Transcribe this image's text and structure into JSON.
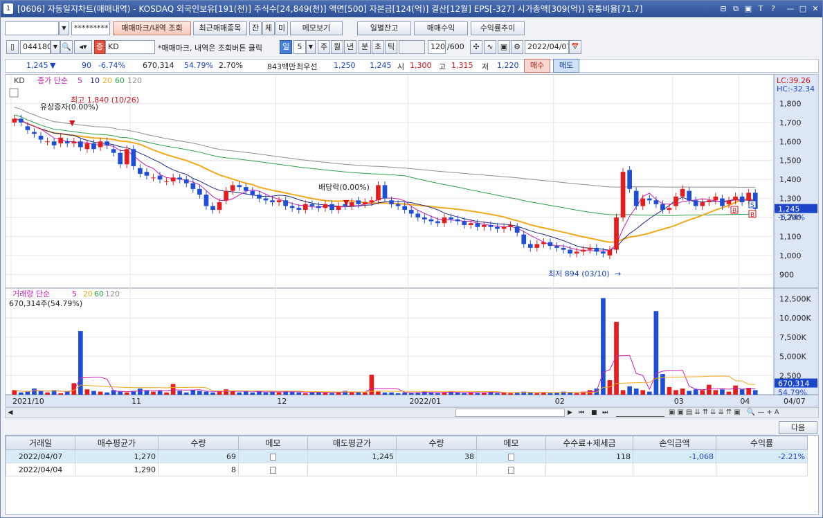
{
  "window": {
    "number": "1",
    "title": "[0606] 자동일지차트(매매내역) - KOSDAQ 외국인보유[191(천)] 주식수[24,849(천)] 액면[500] 자본금[124(억)] 결산[12월] EPS[-327] 시가총액[309(억)] 유통비율[71.7]",
    "controls": [
      "⊟",
      "⧉",
      "▣",
      "T",
      "?",
      "—",
      "□",
      "✕"
    ]
  },
  "toolbar1": {
    "account_value": "",
    "password_value": "*********",
    "btn_trade_mark": "매매마크/내역 조회",
    "btn_recent": "최근매매종목",
    "btn_jan": "잔",
    "btn_che": "체",
    "btn_mi": "미",
    "btn_memo": "메모보기",
    "btn_daily": "일별잔고",
    "btn_profit": "매매수익",
    "btn_yield": "수익률추이"
  },
  "toolbar2": {
    "code": "044180",
    "market": "증",
    "name": "KD",
    "hint": "*매매마크, 내역은 조회버튼 클릭",
    "period_il": "일",
    "period_n": "5",
    "period_ju": "주",
    "period_wol": "월",
    "period_nyeon": "년",
    "period_bun": "분",
    "period_cho": "초",
    "period_tick": "틱",
    "count": "120",
    "count_max": "/600",
    "date": "2022/04/07",
    "search_icon": "🔍",
    "config_icon": "⚙",
    "calendar_icon": "📅"
  },
  "quote": {
    "price": "1,245",
    "arrow": "▼",
    "change": "90",
    "rate": "-6.74%",
    "volume": "670,314",
    "vol_rate": "54.79%",
    "turnover": "2.70%",
    "amount": "843백만",
    "best_label": "최우선",
    "ask": "1,250",
    "bid": "1,245",
    "open_label": "시",
    "open": "1,300",
    "high_label": "고",
    "high": "1,315",
    "low_label": "저",
    "low": "1,220",
    "buy": "매수",
    "sell": "매도"
  },
  "chart_data": [
    {
      "type": "candlestick",
      "title": "KD",
      "legend": [
        "종가 단순",
        "5",
        "10",
        "20",
        "60",
        "120"
      ],
      "colors": {
        "up": "#e41e1e",
        "down": "#1e4ed8",
        "ma5": "#c81fb4",
        "ma10": "#1b2a80",
        "ma20": "#f2a81b",
        "ma60": "#2ea04a",
        "ma120": "#8e8e8e"
      },
      "ylim": [
        850,
        1900
      ],
      "yticks": [
        900,
        1000,
        1100,
        1200,
        1300,
        1400,
        1500,
        1600,
        1700,
        1800
      ],
      "ytick_labels": [
        "900",
        "1,000",
        "1,100",
        "1,200",
        "1,300",
        "1,400",
        "1,500",
        "1,600",
        "1,700",
        "1,800"
      ],
      "x_labels": [
        "2021/10",
        "11",
        "12",
        "2022/01",
        "02",
        "03",
        "04",
        "04/07"
      ],
      "last_price": "1,245",
      "last_rate": "-6.74%",
      "lc": "LC:39.26",
      "hc": "HC:-32.34",
      "annotations": {
        "high": "최고 1,840 (10/26)",
        "low": "최저 894 (03/10)",
        "rights": "유상증자(0.00%)",
        "dividend": "배당락(0.00%)"
      },
      "marks": [
        "S",
        "B",
        "B"
      ],
      "close": [
        1720,
        1700,
        1660,
        1640,
        1610,
        1600,
        1580,
        1620,
        1590,
        1600,
        1570,
        1590,
        1560,
        1600,
        1580,
        1540,
        1480,
        1560,
        1470,
        1430,
        1420,
        1410,
        1400,
        1390,
        1410,
        1400,
        1380,
        1350,
        1320,
        1260,
        1240,
        1280,
        1340,
        1370,
        1360,
        1340,
        1320,
        1300,
        1290,
        1280,
        1290,
        1260,
        1250,
        1240,
        1270,
        1260,
        1250,
        1270,
        1240,
        1260,
        1260,
        1280,
        1270,
        1280,
        1290,
        1370,
        1300,
        1270,
        1260,
        1240,
        1220,
        1200,
        1190,
        1180,
        1170,
        1200,
        1190,
        1180,
        1160,
        1170,
        1150,
        1160,
        1150,
        1140,
        1150,
        1160,
        1120,
        1060,
        1040,
        1060,
        1070,
        1050,
        1040,
        1030,
        1010,
        1020,
        1030,
        1040,
        1020,
        1010,
        1030,
        1200,
        1440,
        1350,
        1260,
        1300,
        1290,
        1270,
        1240,
        1250,
        1310,
        1350,
        1290,
        1260,
        1280,
        1290,
        1310,
        1260,
        1290,
        1310,
        1280,
        1330,
        1245
      ],
      "open": [
        1700,
        1720,
        1680,
        1650,
        1630,
        1600,
        1600,
        1590,
        1600,
        1590,
        1600,
        1560,
        1590,
        1570,
        1600,
        1560,
        1540,
        1480,
        1560,
        1460,
        1440,
        1410,
        1420,
        1390,
        1390,
        1410,
        1400,
        1380,
        1350,
        1320,
        1260,
        1240,
        1290,
        1340,
        1370,
        1360,
        1340,
        1320,
        1300,
        1290,
        1280,
        1290,
        1260,
        1250,
        1240,
        1270,
        1260,
        1250,
        1270,
        1240,
        1270,
        1260,
        1290,
        1270,
        1280,
        1290,
        1370,
        1290,
        1270,
        1260,
        1240,
        1220,
        1200,
        1190,
        1180,
        1170,
        1200,
        1190,
        1180,
        1160,
        1170,
        1150,
        1160,
        1150,
        1140,
        1150,
        1150,
        1110,
        1060,
        1040,
        1060,
        1070,
        1050,
        1040,
        1030,
        1010,
        1020,
        1030,
        1040,
        1020,
        1000,
        1030,
        1200,
        1450,
        1340,
        1260,
        1300,
        1290,
        1270,
        1240,
        1260,
        1310,
        1340,
        1290,
        1260,
        1280,
        1290,
        1300,
        1270,
        1290,
        1310,
        1290,
        1330
      ],
      "volume_title": "거래량 단순",
      "volume_legend": [
        "5",
        "20",
        "60",
        "120"
      ],
      "volume_label": "670,314주(54.79%)",
      "vol_ylim": [
        0,
        13000
      ],
      "vol_yticks": [
        2500,
        5000,
        7500,
        10000,
        12500
      ],
      "vol_ytick_labels": [
        "2,500",
        "5,000K",
        "7,500K",
        "10,000K",
        "12,500K"
      ],
      "vol_last": "670,314",
      "vol_rate": "54.79%",
      "volume": [
        600,
        300,
        400,
        800,
        500,
        300,
        600,
        200,
        400,
        1500,
        8300,
        700,
        500,
        400,
        300,
        600,
        400,
        300,
        500,
        800,
        600,
        400,
        500,
        300,
        1400,
        500,
        300,
        600,
        500,
        400,
        300,
        400,
        700,
        500,
        300,
        400,
        300,
        500,
        300,
        400,
        300,
        500,
        400,
        300,
        200,
        300,
        400,
        300,
        200,
        300,
        500,
        300,
        400,
        300,
        2600,
        400,
        300,
        300,
        200,
        300,
        200,
        300,
        400,
        300,
        200,
        300,
        400,
        300,
        200,
        300,
        200,
        300,
        400,
        200,
        300,
        200,
        300,
        400,
        300,
        200,
        300,
        200,
        300,
        400,
        300,
        200,
        400,
        600,
        800,
        12600,
        1900,
        9500,
        600,
        1100,
        800,
        600,
        400,
        10900,
        2700,
        1000,
        600,
        800,
        500,
        700,
        600,
        1300,
        600,
        700,
        400,
        1200,
        700,
        900,
        600
      ]
    }
  ],
  "scrollbar": {
    "nav": [
      "◀",
      "▶",
      "⏮",
      "■",
      "⏭"
    ]
  },
  "grid": {
    "next": "다음",
    "headers": [
      "거래일",
      "매수평균가",
      "수량",
      "메모",
      "매도평균가",
      "수량",
      "메모",
      "수수료+제세금",
      "손익금액",
      "수익률"
    ],
    "rows": [
      {
        "date": "2022/04/07",
        "buy_avg": "1,270",
        "buy_qty": "69",
        "sell_avg": "1,245",
        "sell_qty": "38",
        "fee": "118",
        "pnl": "-1,068",
        "rate": "-2.21%"
      },
      {
        "date": "2022/04/04",
        "buy_avg": "1,290",
        "buy_qty": "8",
        "sell_avg": "",
        "sell_qty": "",
        "fee": "",
        "pnl": "",
        "rate": ""
      }
    ]
  }
}
